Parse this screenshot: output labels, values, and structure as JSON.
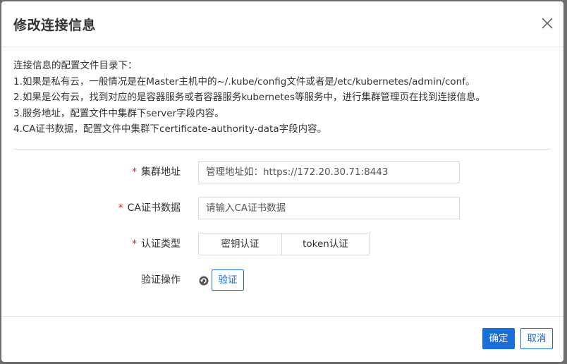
{
  "dialog": {
    "title": "修改连接信息",
    "close_icon": "close-icon"
  },
  "instructions": [
    "连接信息的配置文件目录下：",
    "1.如果是私有云，一般情况是在Master主机中的~/.kube/config文件或者是/etc/kubernetes/admin/conf。",
    "2.如果是公有云，找到对应的是容器服务或者容器服务kubernetes等服务中，进行集群管理页在找到连接信息。",
    "3.服务地址，配置文件中集群下server字段内容。",
    "4.CA证书数据，配置文件中集群下certificate-authority-data字段内容。"
  ],
  "form": {
    "required_mark": "*",
    "cluster_address": {
      "label": "集群地址",
      "value": "",
      "placeholder": "管理地址如：https://172.20.30.71:8443"
    },
    "ca_cert": {
      "label": "CA证书数据",
      "value": "",
      "placeholder": "请输入CA证书数据"
    },
    "auth_type": {
      "label": "认证类型",
      "options": [
        "密钥认证",
        "token认证"
      ]
    },
    "verify": {
      "label": "验证操作",
      "icon": "refresh-icon",
      "button_label": "验证"
    }
  },
  "footer": {
    "ok_label": "确定",
    "cancel_label": "取消"
  },
  "colors": {
    "primary": "#1a6ed8",
    "required": "#e02020",
    "text": "#333333"
  }
}
